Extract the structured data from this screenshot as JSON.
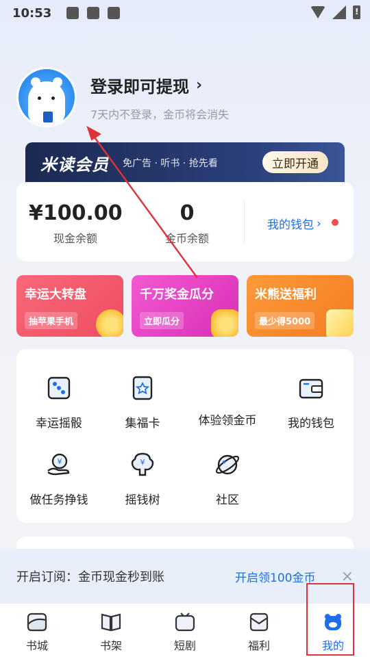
{
  "status_bar": {
    "time": "10:53"
  },
  "profile": {
    "title": "登录即可提现",
    "chevron": "›",
    "subtitle": "7天内不登录，金币将会消失"
  },
  "vip": {
    "title": "米读会员",
    "subtitle": "免广告 · 听书 · 抢先看",
    "button": "立即开通"
  },
  "wallet": {
    "cash_value": "¥100.00",
    "cash_label": "现金余额",
    "coin_value": "0",
    "coin_label": "金币余额",
    "link": "我的钱包",
    "chevron": "›"
  },
  "promos": [
    {
      "title": "幸运大转盘",
      "tag": "抽苹果手机",
      "color": "#f2576b"
    },
    {
      "title": "千万奖金瓜分",
      "tag": "立即瓜分",
      "color": "#e83fc4"
    },
    {
      "title": "米熊送福利",
      "tag": "最少得5000",
      "color": "#f88a2c"
    }
  ],
  "tools": [
    {
      "label": "幸运摇骰",
      "icon": "dice-icon"
    },
    {
      "label": "集福卡",
      "icon": "card-icon"
    },
    {
      "label": "体验领金币",
      "icon": ""
    },
    {
      "label": "我的钱包",
      "icon": "wallet-icon"
    },
    {
      "label": "做任务挣钱",
      "icon": "coin-hand-icon"
    },
    {
      "label": "摇钱树",
      "icon": "money-tree-icon"
    },
    {
      "label": "社区",
      "icon": "planet-icon"
    }
  ],
  "notify": {
    "text": "开启订阅：金币现金秒到账",
    "link": "开启领100金币",
    "close": "×"
  },
  "tabs": [
    {
      "label": "书城",
      "icon": "bookstore-icon"
    },
    {
      "label": "书架",
      "icon": "bookshelf-icon"
    },
    {
      "label": "短剧",
      "icon": "tv-icon"
    },
    {
      "label": "福利",
      "icon": "envelope-icon"
    },
    {
      "label": "我的",
      "icon": "bear-icon",
      "active": true
    }
  ],
  "colors": {
    "accent": "#1e6ee8",
    "annotation": "#e0303a"
  }
}
